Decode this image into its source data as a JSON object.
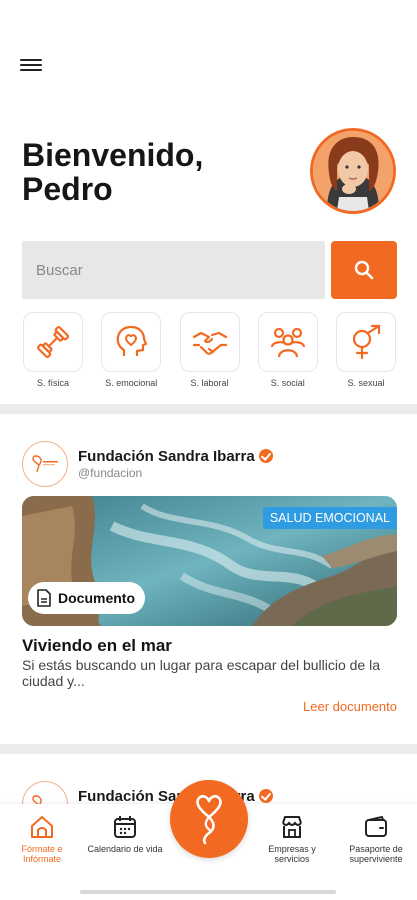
{
  "header": {
    "menu_icon": "hamburger-menu-icon",
    "greeting_line1": "Bienvenido,",
    "greeting_line2": "Pedro",
    "avatar_icon": "user-avatar"
  },
  "search": {
    "placeholder": "Buscar",
    "value": "",
    "button_icon": "search-icon"
  },
  "categories": [
    {
      "label": "S. física",
      "icon": "dumbbell-icon"
    },
    {
      "label": "S. emocional",
      "icon": "head-heart-icon"
    },
    {
      "label": "S. laboral",
      "icon": "handshake-icon"
    },
    {
      "label": "S. social",
      "icon": "people-icon"
    },
    {
      "label": "S. sexual",
      "icon": "gender-icon"
    }
  ],
  "posts": [
    {
      "org_name": "Fundación Sandra Ibarra",
      "handle": "@fundacion",
      "tag": "SALUD EMOCIONAL",
      "type_label": "Documento",
      "title": "Viviendo en el mar",
      "excerpt": "Si estás buscando un lugar para escapar del bullicio de la ciudad y...",
      "link": "Leer documento"
    },
    {
      "org_name": "Fundación Sandra Ibarra"
    }
  ],
  "nav": [
    {
      "label": "Fórmate e Infórmate",
      "icon": "home-icon",
      "active": true
    },
    {
      "label": "Calendario de vida",
      "icon": "calendar-icon",
      "active": false
    },
    {
      "label": "Empresas y servicios",
      "icon": "store-icon",
      "active": false
    },
    {
      "label": "Pasaporte de superviviente",
      "icon": "wallet-icon",
      "active": false
    }
  ],
  "colors": {
    "accent": "#f26a21",
    "tag_blue": "#2f9be0",
    "search_bg": "#e7e7e7",
    "separator": "#ececec"
  }
}
